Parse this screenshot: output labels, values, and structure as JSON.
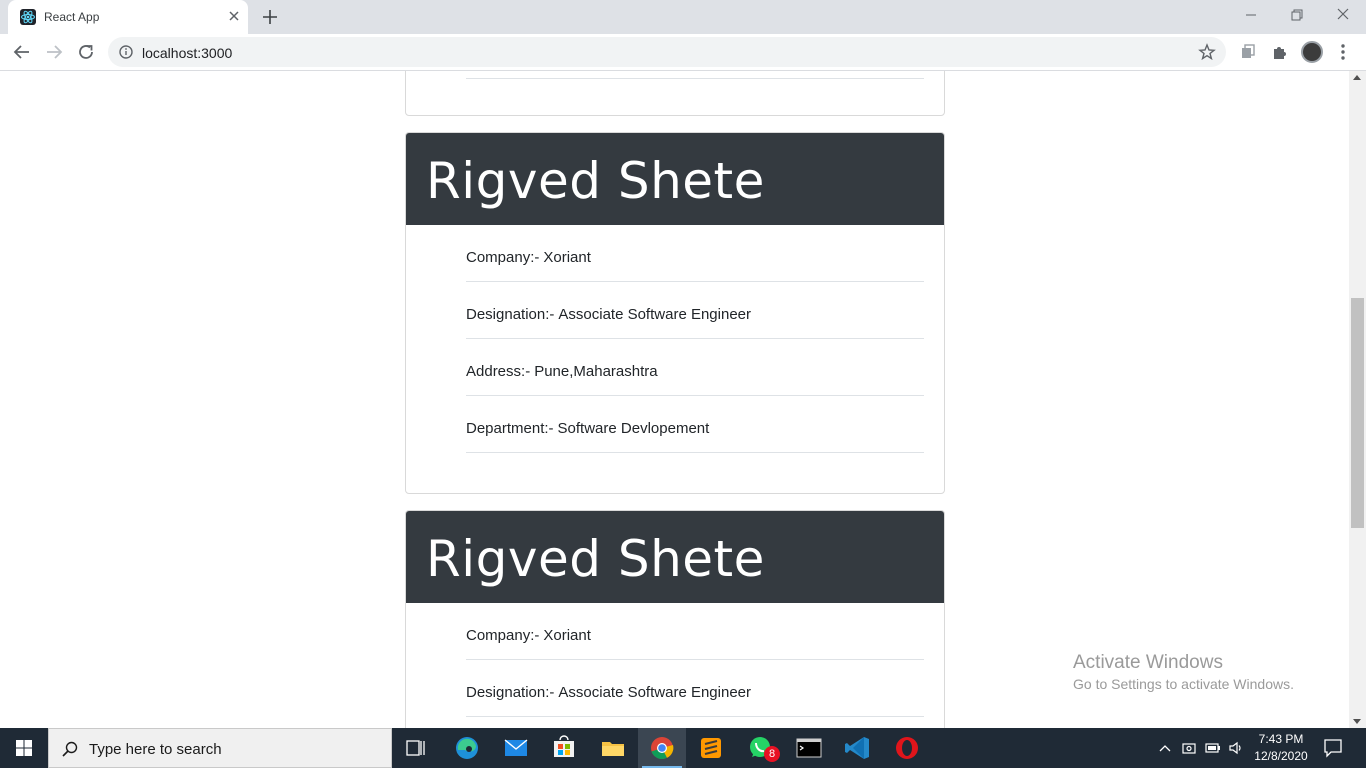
{
  "browser": {
    "tab_title": "React App",
    "url": "localhost:3000"
  },
  "cards": [
    {
      "name": "Rigved Shete",
      "rows": [
        {
          "label": "Company:-",
          "value": "Xoriant"
        },
        {
          "label": "Designation:-",
          "value": "Associate Software Engineer"
        },
        {
          "label": "Address:-",
          "value": "Pune,Maharashtra"
        },
        {
          "label": "Department:-",
          "value": "Software Devlopement"
        }
      ]
    },
    {
      "name": "Rigved Shete",
      "rows": [
        {
          "label": "Company:-",
          "value": "Xoriant"
        },
        {
          "label": "Designation:-",
          "value": "Associate Software Engineer"
        }
      ]
    }
  ],
  "watermark": {
    "title": "Activate Windows",
    "subtitle": "Go to Settings to activate Windows."
  },
  "taskbar": {
    "search_placeholder": "Type here to search",
    "whatsapp_badge": "8",
    "time": "7:43 PM",
    "date": "12/8/2020",
    "colors": {
      "bar": "#1f2a36",
      "active_indicator": "#76b9ed"
    }
  },
  "theme": {
    "card_header_bg": "#343a40",
    "page_bg": "#ffffff"
  }
}
